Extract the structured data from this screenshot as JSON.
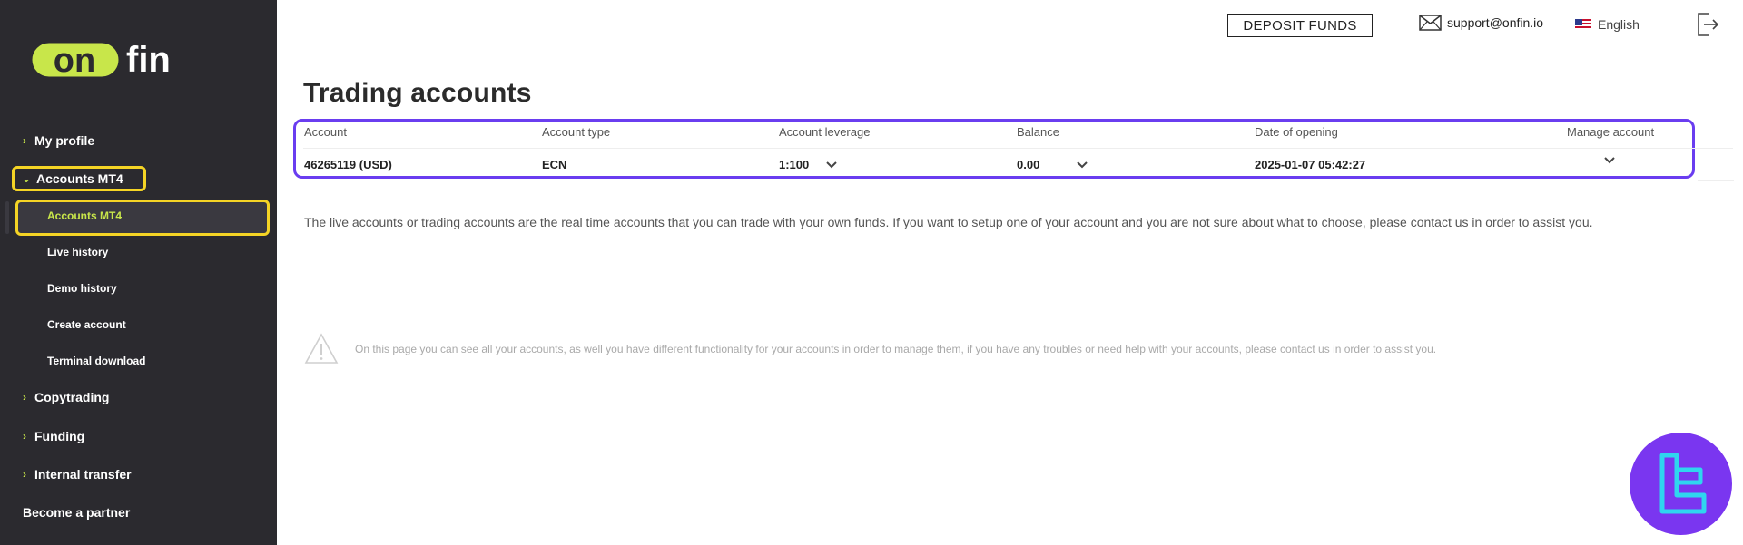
{
  "brand": {
    "logo_left": "on",
    "logo_right": "fin",
    "accent": "#c8e64a",
    "sidebar_bg": "#2b2a2f"
  },
  "topbar": {
    "deposit_label": "DEPOSIT FUNDS",
    "support_email": "support@onfin.io",
    "language": "English",
    "mail_icon": "mail-icon",
    "flag_icon": "us-flag-icon",
    "logout_icon": "logout-icon"
  },
  "sidebar": {
    "items": [
      {
        "label": "My profile",
        "expanded": false
      },
      {
        "label": "Accounts MT4",
        "expanded": true
      },
      {
        "label": "Copytrading",
        "expanded": false
      },
      {
        "label": "Funding",
        "expanded": false
      },
      {
        "label": "Internal transfer",
        "expanded": false
      },
      {
        "label": "Become a partner",
        "expanded": false
      }
    ],
    "subitems": [
      {
        "label": "Accounts MT4",
        "active": true
      },
      {
        "label": "Live history",
        "active": false
      },
      {
        "label": "Demo history",
        "active": false
      },
      {
        "label": "Create account",
        "active": false
      },
      {
        "label": "Terminal download",
        "active": false
      }
    ]
  },
  "main": {
    "title": "Trading accounts",
    "table": {
      "headers": [
        "Account",
        "Account type",
        "Account leverage",
        "Balance",
        "Date of opening",
        "Manage account"
      ],
      "rows": [
        {
          "account": "46265119  (USD)",
          "type": "ECN",
          "leverage": "1:100",
          "balance": "0.00",
          "date": "2025-01-07 05:42:27"
        }
      ]
    },
    "info": "The live accounts or trading accounts are the real time accounts that you can trade with your own funds. If you want to setup one of your account and you are not sure about what to choose, please contact us in order to assist you.",
    "notice": "On this page you can see all your accounts, as well you have different functionality for your accounts in order to manage them, if you have any troubles or need help with your accounts, please contact us in order to assist you.",
    "notice_icon": "warning-icon"
  },
  "badge": {
    "icon": "tc-badge-icon",
    "color": "#7a36f0"
  },
  "highlights": {
    "sidebar": "#f5d425",
    "table": "#6a3df0"
  }
}
